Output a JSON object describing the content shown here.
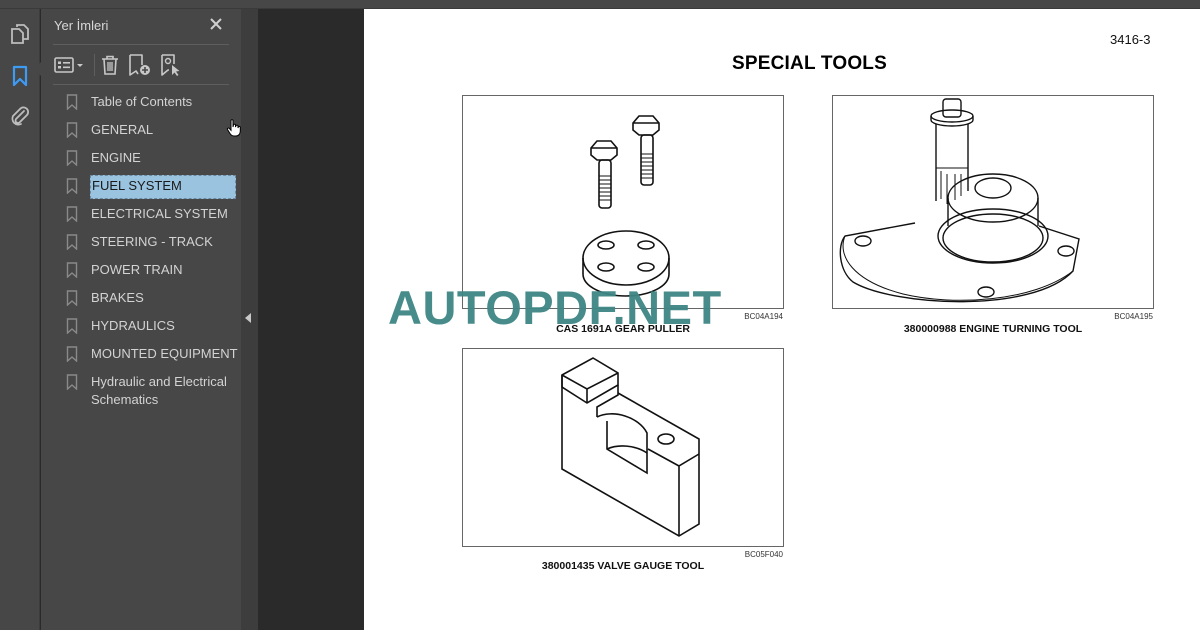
{
  "viewer": {
    "left_rail": {
      "items": [
        {
          "icon": "pages-icon",
          "active": false
        },
        {
          "icon": "bookmark-icon",
          "active": true
        },
        {
          "icon": "attachment-icon",
          "active": false
        }
      ],
      "active_color": "#3e9bf4"
    },
    "bookmarks_panel": {
      "title": "Yer İmleri",
      "toolbar": [
        "options-menu-icon",
        "delete-icon",
        "add-bookmark-icon",
        "bookmark-properties-icon"
      ],
      "items": [
        {
          "label": "Table of Contents",
          "selected": false
        },
        {
          "label": "GENERAL",
          "selected": false
        },
        {
          "label": "ENGINE",
          "selected": false
        },
        {
          "label": "FUEL SYSTEM",
          "selected": true
        },
        {
          "label": "ELECTRICAL SYSTEM",
          "selected": false
        },
        {
          "label": "STEERING - TRACK",
          "selected": false
        },
        {
          "label": "POWER TRAIN",
          "selected": false
        },
        {
          "label": "BRAKES",
          "selected": false
        },
        {
          "label": "HYDRAULICS",
          "selected": false
        },
        {
          "label": "MOUNTED EQUIPMENT",
          "selected": false
        },
        {
          "label": "Hydraulic and Electrical Schematics",
          "selected": false
        }
      ],
      "selection_color": "#9ac3e0"
    }
  },
  "document": {
    "page_number": "3416-3",
    "title": "SPECIAL TOOLS",
    "figures": [
      {
        "code": "BC04A194",
        "caption": "CAS 1691A GEAR PULLER"
      },
      {
        "code": "BC04A195",
        "caption": "380000988 ENGINE TURNING TOOL"
      },
      {
        "code": "BC05F040",
        "caption": "380001435 VALVE GAUGE TOOL"
      }
    ],
    "watermark": "AUTOPDF.NET",
    "watermark_color": "#3e8685"
  }
}
